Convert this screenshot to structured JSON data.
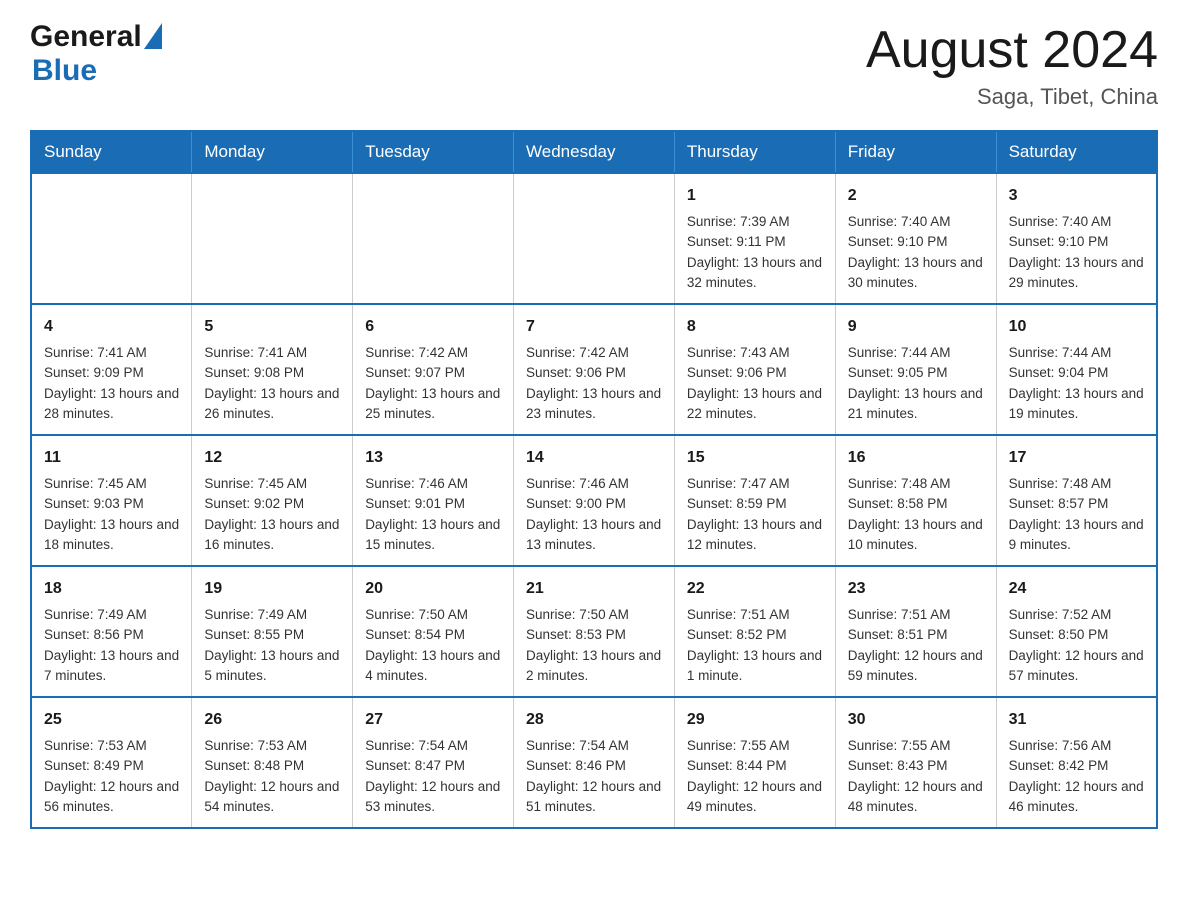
{
  "header": {
    "logo_general": "General",
    "logo_triangle": "▲",
    "logo_blue": "Blue",
    "month_title": "August 2024",
    "location": "Saga, Tibet, China"
  },
  "calendar": {
    "days_of_week": [
      "Sunday",
      "Monday",
      "Tuesday",
      "Wednesday",
      "Thursday",
      "Friday",
      "Saturday"
    ],
    "weeks": [
      [
        {
          "day": "",
          "info": ""
        },
        {
          "day": "",
          "info": ""
        },
        {
          "day": "",
          "info": ""
        },
        {
          "day": "",
          "info": ""
        },
        {
          "day": "1",
          "info": "Sunrise: 7:39 AM\nSunset: 9:11 PM\nDaylight: 13 hours and 32 minutes."
        },
        {
          "day": "2",
          "info": "Sunrise: 7:40 AM\nSunset: 9:10 PM\nDaylight: 13 hours and 30 minutes."
        },
        {
          "day": "3",
          "info": "Sunrise: 7:40 AM\nSunset: 9:10 PM\nDaylight: 13 hours and 29 minutes."
        }
      ],
      [
        {
          "day": "4",
          "info": "Sunrise: 7:41 AM\nSunset: 9:09 PM\nDaylight: 13 hours and 28 minutes."
        },
        {
          "day": "5",
          "info": "Sunrise: 7:41 AM\nSunset: 9:08 PM\nDaylight: 13 hours and 26 minutes."
        },
        {
          "day": "6",
          "info": "Sunrise: 7:42 AM\nSunset: 9:07 PM\nDaylight: 13 hours and 25 minutes."
        },
        {
          "day": "7",
          "info": "Sunrise: 7:42 AM\nSunset: 9:06 PM\nDaylight: 13 hours and 23 minutes."
        },
        {
          "day": "8",
          "info": "Sunrise: 7:43 AM\nSunset: 9:06 PM\nDaylight: 13 hours and 22 minutes."
        },
        {
          "day": "9",
          "info": "Sunrise: 7:44 AM\nSunset: 9:05 PM\nDaylight: 13 hours and 21 minutes."
        },
        {
          "day": "10",
          "info": "Sunrise: 7:44 AM\nSunset: 9:04 PM\nDaylight: 13 hours and 19 minutes."
        }
      ],
      [
        {
          "day": "11",
          "info": "Sunrise: 7:45 AM\nSunset: 9:03 PM\nDaylight: 13 hours and 18 minutes."
        },
        {
          "day": "12",
          "info": "Sunrise: 7:45 AM\nSunset: 9:02 PM\nDaylight: 13 hours and 16 minutes."
        },
        {
          "day": "13",
          "info": "Sunrise: 7:46 AM\nSunset: 9:01 PM\nDaylight: 13 hours and 15 minutes."
        },
        {
          "day": "14",
          "info": "Sunrise: 7:46 AM\nSunset: 9:00 PM\nDaylight: 13 hours and 13 minutes."
        },
        {
          "day": "15",
          "info": "Sunrise: 7:47 AM\nSunset: 8:59 PM\nDaylight: 13 hours and 12 minutes."
        },
        {
          "day": "16",
          "info": "Sunrise: 7:48 AM\nSunset: 8:58 PM\nDaylight: 13 hours and 10 minutes."
        },
        {
          "day": "17",
          "info": "Sunrise: 7:48 AM\nSunset: 8:57 PM\nDaylight: 13 hours and 9 minutes."
        }
      ],
      [
        {
          "day": "18",
          "info": "Sunrise: 7:49 AM\nSunset: 8:56 PM\nDaylight: 13 hours and 7 minutes."
        },
        {
          "day": "19",
          "info": "Sunrise: 7:49 AM\nSunset: 8:55 PM\nDaylight: 13 hours and 5 minutes."
        },
        {
          "day": "20",
          "info": "Sunrise: 7:50 AM\nSunset: 8:54 PM\nDaylight: 13 hours and 4 minutes."
        },
        {
          "day": "21",
          "info": "Sunrise: 7:50 AM\nSunset: 8:53 PM\nDaylight: 13 hours and 2 minutes."
        },
        {
          "day": "22",
          "info": "Sunrise: 7:51 AM\nSunset: 8:52 PM\nDaylight: 13 hours and 1 minute."
        },
        {
          "day": "23",
          "info": "Sunrise: 7:51 AM\nSunset: 8:51 PM\nDaylight: 12 hours and 59 minutes."
        },
        {
          "day": "24",
          "info": "Sunrise: 7:52 AM\nSunset: 8:50 PM\nDaylight: 12 hours and 57 minutes."
        }
      ],
      [
        {
          "day": "25",
          "info": "Sunrise: 7:53 AM\nSunset: 8:49 PM\nDaylight: 12 hours and 56 minutes."
        },
        {
          "day": "26",
          "info": "Sunrise: 7:53 AM\nSunset: 8:48 PM\nDaylight: 12 hours and 54 minutes."
        },
        {
          "day": "27",
          "info": "Sunrise: 7:54 AM\nSunset: 8:47 PM\nDaylight: 12 hours and 53 minutes."
        },
        {
          "day": "28",
          "info": "Sunrise: 7:54 AM\nSunset: 8:46 PM\nDaylight: 12 hours and 51 minutes."
        },
        {
          "day": "29",
          "info": "Sunrise: 7:55 AM\nSunset: 8:44 PM\nDaylight: 12 hours and 49 minutes."
        },
        {
          "day": "30",
          "info": "Sunrise: 7:55 AM\nSunset: 8:43 PM\nDaylight: 12 hours and 48 minutes."
        },
        {
          "day": "31",
          "info": "Sunrise: 7:56 AM\nSunset: 8:42 PM\nDaylight: 12 hours and 46 minutes."
        }
      ]
    ]
  }
}
